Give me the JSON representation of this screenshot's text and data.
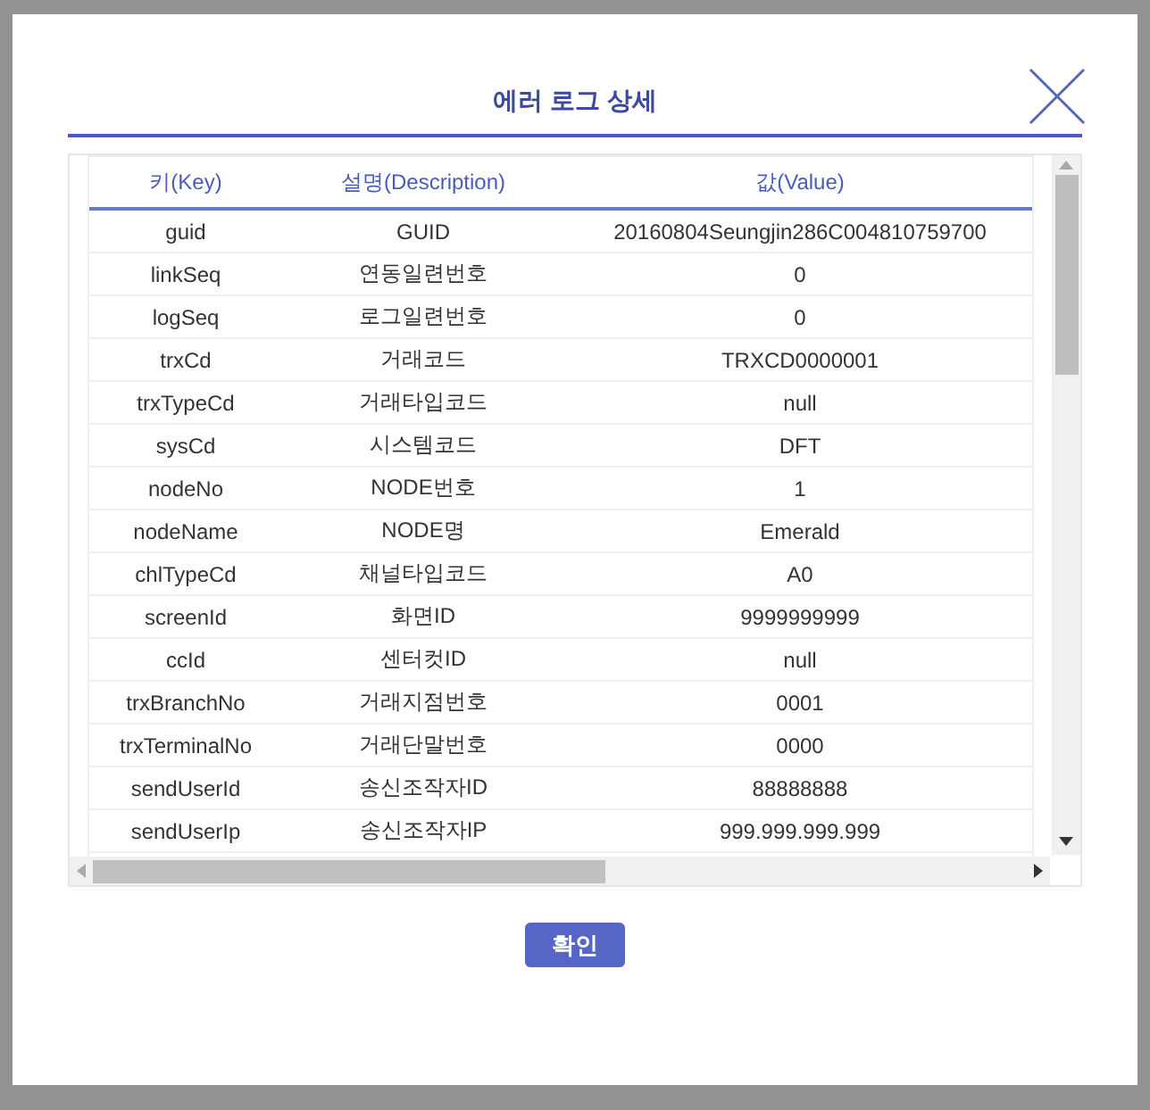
{
  "dialog": {
    "title": "에러 로그 상세",
    "table": {
      "columns": [
        "키(Key)",
        "설명(Description)",
        "값(Value)"
      ],
      "rows": [
        {
          "key": "guid",
          "description": "GUID",
          "value": "20160804Seungjin286C004810759700"
        },
        {
          "key": "linkSeq",
          "description": "연동일련번호",
          "value": "0"
        },
        {
          "key": "logSeq",
          "description": "로그일련번호",
          "value": "0"
        },
        {
          "key": "trxCd",
          "description": "거래코드",
          "value": "TRXCD0000001"
        },
        {
          "key": "trxTypeCd",
          "description": "거래타입코드",
          "value": "null"
        },
        {
          "key": "sysCd",
          "description": "시스템코드",
          "value": "DFT"
        },
        {
          "key": "nodeNo",
          "description": "NODE번호",
          "value": "1"
        },
        {
          "key": "nodeName",
          "description": "NODE명",
          "value": "Emerald"
        },
        {
          "key": "chlTypeCd",
          "description": "채널타입코드",
          "value": "A0"
        },
        {
          "key": "screenId",
          "description": "화면ID",
          "value": "9999999999"
        },
        {
          "key": "ccId",
          "description": "센터컷ID",
          "value": "null"
        },
        {
          "key": "trxBranchNo",
          "description": "거래지점번호",
          "value": "0001"
        },
        {
          "key": "trxTerminalNo",
          "description": "거래단말번호",
          "value": "0000"
        },
        {
          "key": "sendUserId",
          "description": "송신조작자ID",
          "value": "88888888"
        },
        {
          "key": "sendUserIp",
          "description": "송신조작자IP",
          "value": "999.999.999.999"
        }
      ]
    },
    "confirm_button": "확인"
  }
}
